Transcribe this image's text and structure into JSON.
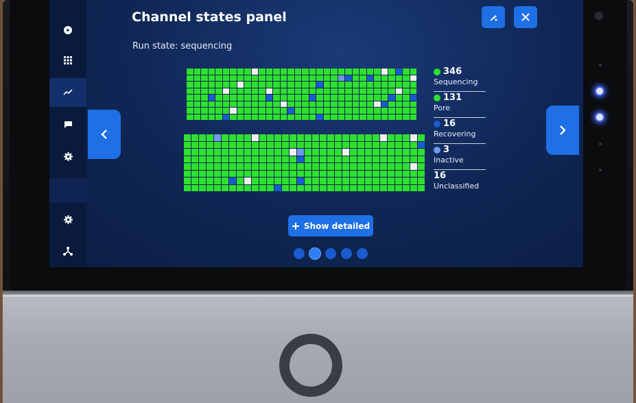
{
  "panel": {
    "title": "Channel states panel",
    "run_state": "Run state: sequencing",
    "show_detailed_label": "Show detailed"
  },
  "icons": {
    "edit": "brush-icon",
    "close": "close-icon",
    "prev": "chevron-left-icon",
    "next": "chevron-right-icon"
  },
  "sidebar": {
    "items": [
      {
        "icon": "play-icon"
      },
      {
        "icon": "grid-icon"
      },
      {
        "icon": "chart-icon",
        "active": true
      },
      {
        "icon": "message-icon"
      },
      {
        "icon": "gear-icon"
      },
      {
        "icon": "gear-icon"
      },
      {
        "icon": "network-icon"
      }
    ]
  },
  "legend": {
    "items": [
      {
        "count": "346",
        "label": "Sequencing",
        "color": "#2fe02f"
      },
      {
        "count": "131",
        "label": "Pore",
        "color": "#2fe02f"
      },
      {
        "count": "16",
        "label": "Recovering",
        "color": "#1a5ccf"
      },
      {
        "count": "3",
        "label": "Inactive",
        "color": "#6f9ae8"
      },
      {
        "count": "16",
        "label": "Unclassified",
        "color": ""
      }
    ]
  },
  "pagination": {
    "count": 5,
    "active": 1
  },
  "colors": {
    "accent": "#1f6fe5",
    "channel_sequencing": "#2fe02f",
    "channel_recovering": "#1a5ccf",
    "channel_inactive": "#6f9ae8",
    "channel_unclassified": "#f0f0f0"
  }
}
